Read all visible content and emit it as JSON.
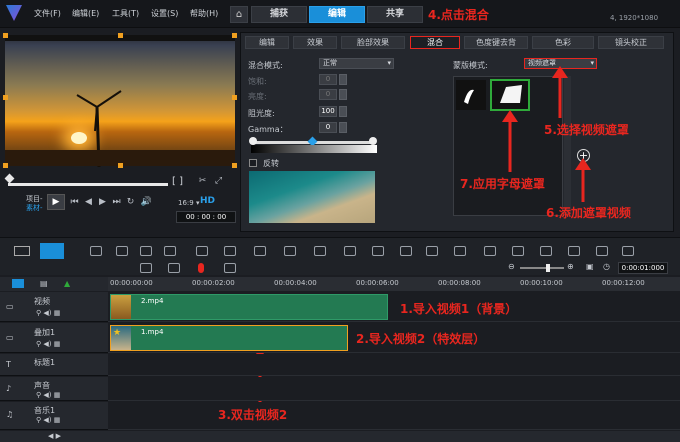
{
  "menu": {
    "file": "文件(F)",
    "edit": "编辑(E)",
    "tools": "工具(T)",
    "settings": "设置(S)",
    "help": "帮助(H)"
  },
  "tabs": {
    "home": "⌂",
    "capture": "捕获",
    "edit": "编辑",
    "share": "共享"
  },
  "resolution": "4, 1920*1080",
  "annotations": {
    "a1": "1.导入视频1（背景）",
    "a2": "2.导入视频2（特效层）",
    "a3": "3.双击视频2",
    "a4": "4.点击混合",
    "a5": "5.选择视频遮罩",
    "a6": "6.添加遮罩视频",
    "a7": "7.应用字母遮罩"
  },
  "player": {
    "project": "项目-",
    "clip": "素材-",
    "timecode": "00 : 00 : 00",
    "hd": "HD"
  },
  "panel": {
    "tabs": [
      "编辑",
      "效果",
      "脸部效果",
      "混合",
      "色度键去背",
      "色彩",
      "镜头校正"
    ],
    "blend_mode_label": "混合模式:",
    "blend_mode_value": "正常",
    "hue_label": "饱和:",
    "hue_value": "0",
    "brightness_label": "亮度:",
    "brightness_value": "0",
    "opacity_label": "阻光度:",
    "opacity_value": "100",
    "gamma_label": "Gamma：",
    "gamma_value": "0",
    "invert_label": "反转",
    "mask_mode_label": "蒙版模式:",
    "mask_mode_value": "视频遮罩"
  },
  "timeline": {
    "ruler": [
      "00:00:00:00",
      "00:00:02:00",
      "00:00:04:00",
      "00:00:06:00",
      "00:00:08:00",
      "00:00:10:00",
      "00:00:12:00"
    ],
    "timecode": "0:00:01:000",
    "tracks": [
      {
        "name": "视频"
      },
      {
        "name": "叠加1"
      },
      {
        "name": "标题1"
      },
      {
        "name": "声音"
      },
      {
        "name": "音乐1"
      }
    ],
    "clips": {
      "video": "2.mp4",
      "overlay": "1.mp4"
    }
  },
  "colors": {
    "accent": "#1a8fd9",
    "annotation": "#e8261f",
    "clip": "#237a52"
  }
}
